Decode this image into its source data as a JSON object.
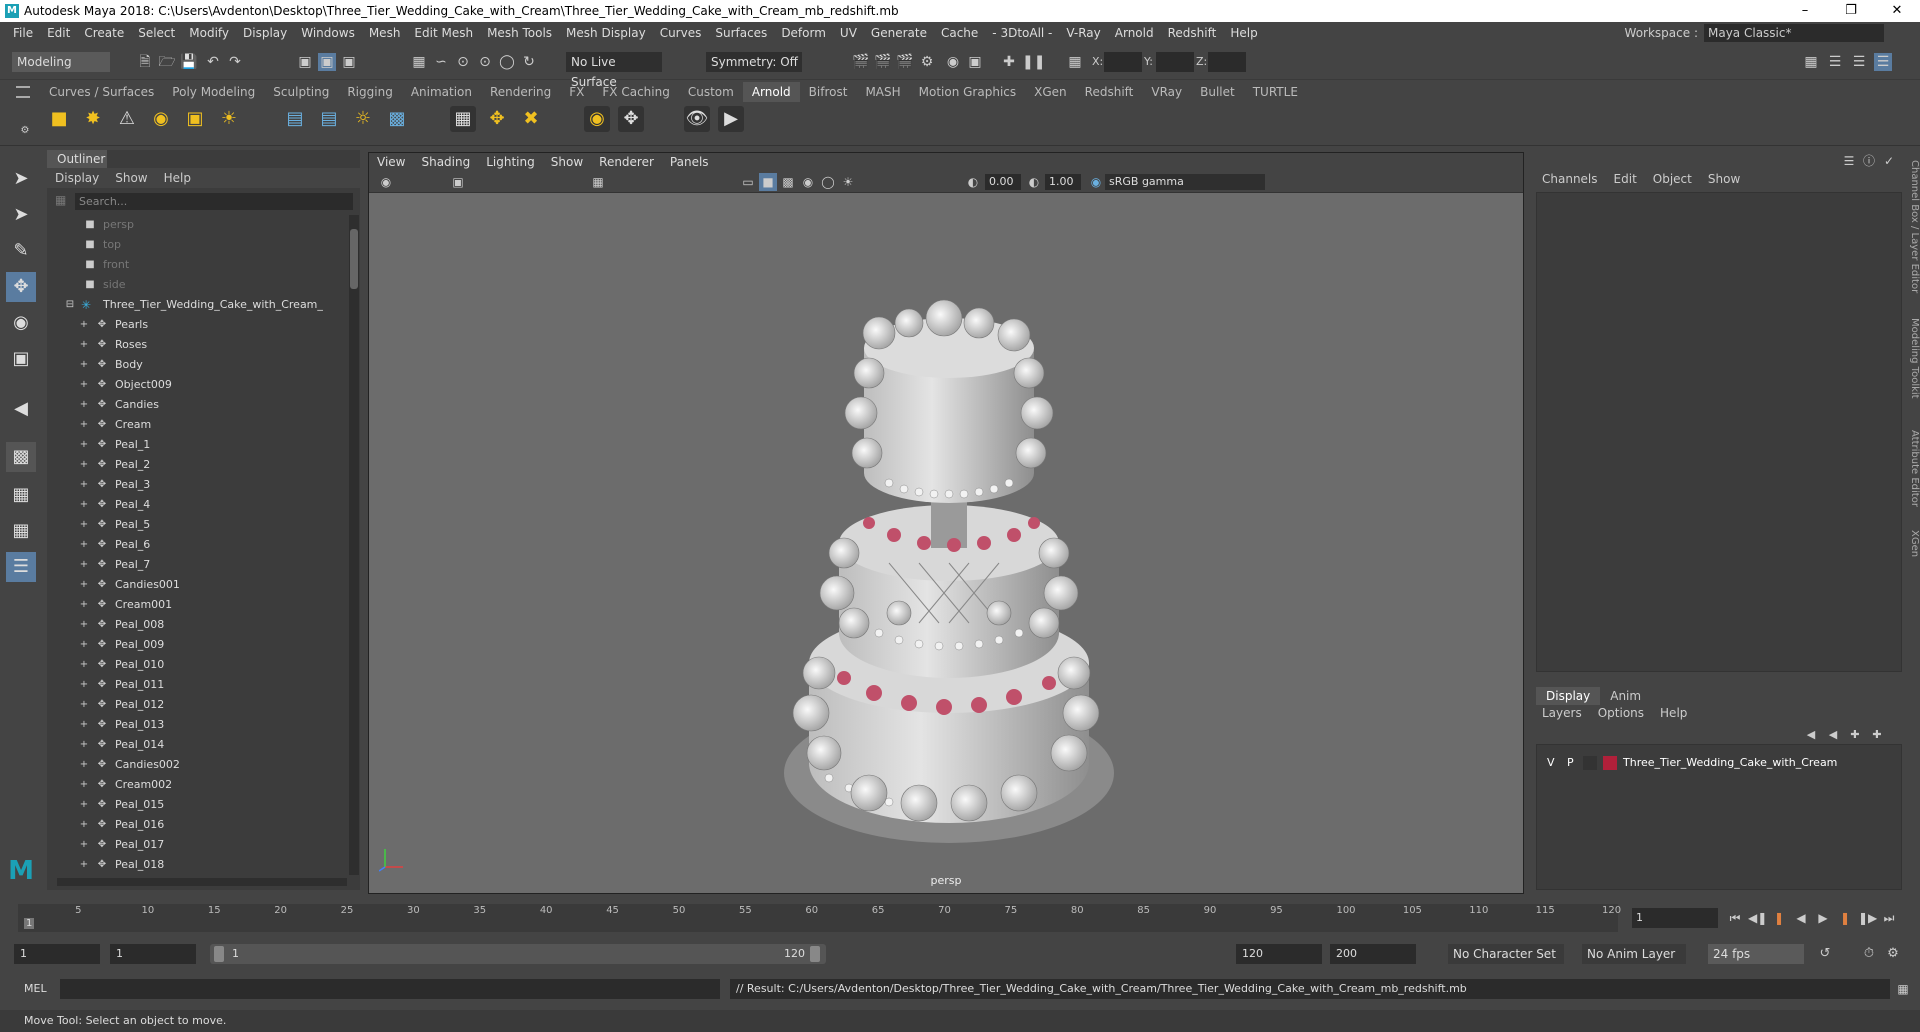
{
  "window": {
    "title": "Autodesk Maya 2018: C:\\Users\\Avdenton\\Desktop\\Three_Tier_Wedding_Cake_with_Cream\\Three_Tier_Wedding_Cake_with_Cream_mb_redshift.mb",
    "logo_letter": "M"
  },
  "menubar": [
    "File",
    "Edit",
    "Create",
    "Select",
    "Modify",
    "Display",
    "Windows",
    "Mesh",
    "Edit Mesh",
    "Mesh Tools",
    "Mesh Display",
    "Curves",
    "Surfaces",
    "Deform",
    "UV",
    "Generate",
    "Cache",
    "- 3DtoAll -",
    "V-Ray",
    "Arnold",
    "Redshift",
    "Help"
  ],
  "workspace": {
    "label": "Workspace :",
    "value": "Maya Classic*"
  },
  "statusline": {
    "mode": "Modeling",
    "live_surface": "No Live Surface",
    "symmetry": "Symmetry: Off",
    "x_label": "X:",
    "y_label": "Y:",
    "z_label": "Z:"
  },
  "shelf_tabs": [
    "Curves / Surfaces",
    "Poly Modeling",
    "Sculpting",
    "Rigging",
    "Animation",
    "Rendering",
    "FX",
    "FX Caching",
    "Custom",
    "Arnold",
    "Bifrost",
    "MASH",
    "Motion Graphics",
    "XGen",
    "Redshift",
    "VRay",
    "Bullet",
    "TURTLE"
  ],
  "active_shelf_tab": "Arnold",
  "outliner": {
    "tab": "Outliner",
    "menu": [
      "Display",
      "Show",
      "Help"
    ],
    "search_placeholder": "Search...",
    "cameras": [
      "persp",
      "top",
      "front",
      "side"
    ],
    "group": "Three_Tier_Wedding_Cake_with_Cream_",
    "items": [
      "Pearls",
      "Roses",
      "Body",
      "Object009",
      "Candies",
      "Cream",
      "Peal_1",
      "Peal_2",
      "Peal_3",
      "Peal_4",
      "Peal_5",
      "Peal_6",
      "Peal_7",
      "Candies001",
      "Cream001",
      "Peal_008",
      "Peal_009",
      "Peal_010",
      "Peal_011",
      "Peal_012",
      "Peal_013",
      "Peal_014",
      "Candies002",
      "Cream002",
      "Peal_015",
      "Peal_016",
      "Peal_017",
      "Peal_018"
    ]
  },
  "viewport": {
    "menu": [
      "View",
      "Shading",
      "Lighting",
      "Show",
      "Renderer",
      "Panels"
    ],
    "exposure": "0.00",
    "gamma": "1.00",
    "color_space": "sRGB gamma",
    "camera": "persp"
  },
  "channelbox": {
    "menu": [
      "Channels",
      "Edit",
      "Object",
      "Show"
    ],
    "layer_tabs": [
      "Display",
      "Anim"
    ],
    "layer_menu": [
      "Layers",
      "Options",
      "Help"
    ],
    "layer": {
      "v": "V",
      "p": "P",
      "name": "Three_Tier_Wedding_Cake_with_Cream",
      "color": "#b0203a"
    }
  },
  "side_tabs": [
    "Channel Box / Layer Editor",
    "Modeling Toolkit",
    "Attribute Editor",
    "XGen"
  ],
  "timeline": {
    "ticks": [
      "5",
      "10",
      "15",
      "20",
      "25",
      "30",
      "35",
      "40",
      "45",
      "50",
      "55",
      "60",
      "65",
      "70",
      "75",
      "80",
      "85",
      "90",
      "95",
      "100",
      "105",
      "110",
      "115",
      "120"
    ],
    "current_frame_marker": "1",
    "current_frame": "1"
  },
  "range": {
    "start": "1",
    "anim_start": "1",
    "slider_start": "1",
    "slider_end": "120",
    "end": "120",
    "anim_end": "200",
    "character_set": "No Character Set",
    "anim_layer": "No Anim Layer",
    "fps": "24 fps"
  },
  "command": {
    "lang": "MEL",
    "result": "// Result: C:/Users/Avdenton/Desktop/Three_Tier_Wedding_Cake_with_Cream/Three_Tier_Wedding_Cake_with_Cream_mb_redshift.mb"
  },
  "helpline": "Move Tool: Select an object to move."
}
